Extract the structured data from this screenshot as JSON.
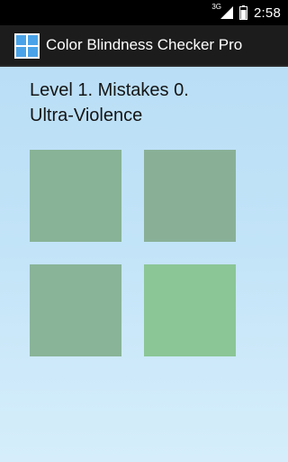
{
  "status_bar": {
    "network": "3G",
    "time": "2:58",
    "icons": [
      "signal-icon",
      "battery-icon"
    ]
  },
  "action_bar": {
    "title": "Color Blindness Checker Pro",
    "icon": "app-grid-icon"
  },
  "game": {
    "status_line": "Level 1. Mistakes 0.",
    "mode": "Ultra-Violence",
    "tiles": [
      {
        "color": "#88b396"
      },
      {
        "color": "#89b097"
      },
      {
        "color": "#89b498"
      },
      {
        "color": "#8bc696"
      }
    ]
  },
  "colors": {
    "background_top": "#b6dcf5",
    "background_bottom": "#d6eefb",
    "action_bar": "#1c1c1c",
    "status_bar": "#000000",
    "app_icon_blue": "#4aa3e8"
  }
}
